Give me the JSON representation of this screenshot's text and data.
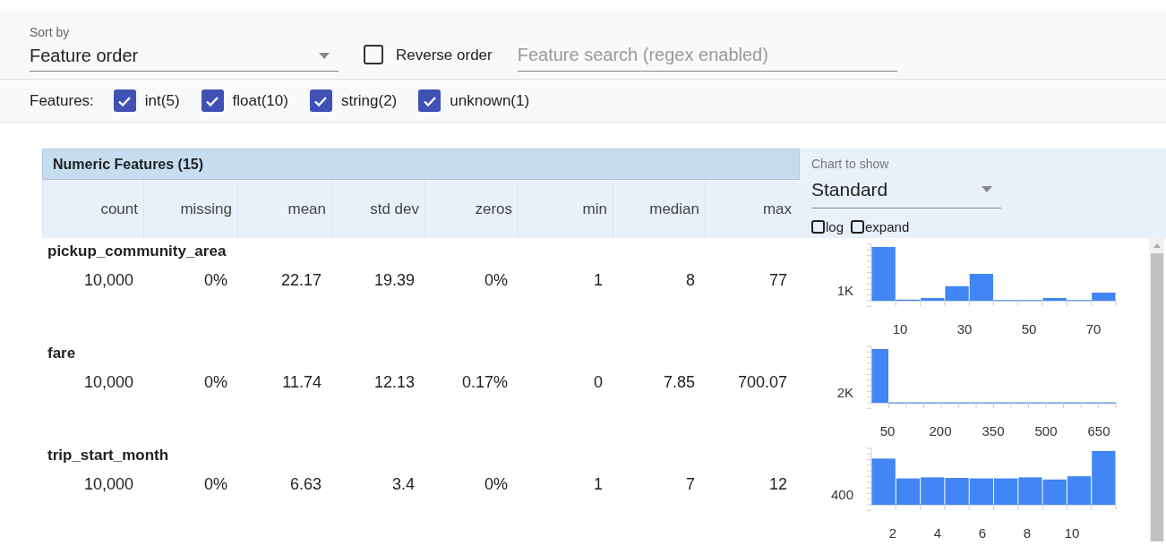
{
  "sort": {
    "label": "Sort by",
    "value": "Feature order"
  },
  "reverse": {
    "label": "Reverse order",
    "checked": false
  },
  "search": {
    "placeholder": "Feature search (regex enabled)"
  },
  "features": {
    "label": "Features:",
    "types": [
      {
        "label": "int(5)",
        "checked": true
      },
      {
        "label": "float(10)",
        "checked": true
      },
      {
        "label": "string(2)",
        "checked": true
      },
      {
        "label": "unknown(1)",
        "checked": true
      }
    ]
  },
  "table": {
    "title": "Numeric Features (15)",
    "columns": [
      "count",
      "missing",
      "mean",
      "std dev",
      "zeros",
      "min",
      "median",
      "max"
    ],
    "rows": [
      {
        "name": "pickup_community_area",
        "cells": [
          "10,000",
          "0%",
          "22.17",
          "19.39",
          "0%",
          "1",
          "8",
          "77"
        ],
        "histogram": {
          "y_label": "1K",
          "x_labels": [
            "10",
            "30",
            "50",
            "70"
          ]
        }
      },
      {
        "name": "fare",
        "cells": [
          "10,000",
          "0%",
          "11.74",
          "12.13",
          "0.17%",
          "0",
          "7.85",
          "700.07"
        ],
        "histogram": {
          "y_label": "2K",
          "x_labels": [
            "50",
            "200",
            "350",
            "500",
            "650"
          ]
        }
      },
      {
        "name": "trip_start_month",
        "cells": [
          "10,000",
          "0%",
          "6.63",
          "3.4",
          "0%",
          "1",
          "7",
          "12"
        ],
        "histogram": {
          "y_label": "400",
          "x_labels": [
            "2",
            "4",
            "6",
            "8",
            "10"
          ]
        }
      }
    ]
  },
  "chart_options": {
    "label": "Chart to show",
    "value": "Standard",
    "log": {
      "label": "log",
      "checked": false
    },
    "expand": {
      "label": "expand",
      "checked": false
    }
  }
}
